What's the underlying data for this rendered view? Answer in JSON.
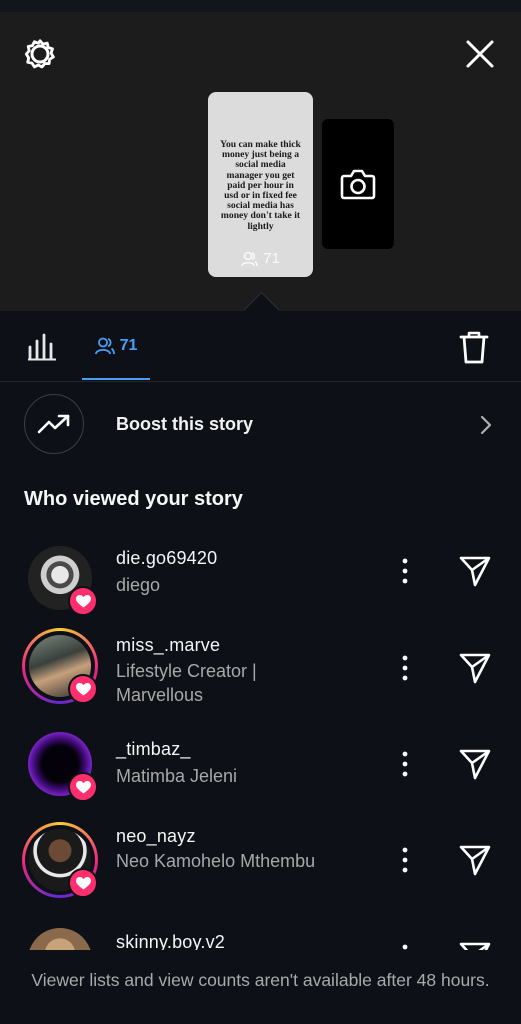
{
  "story": {
    "text": "You can make thick money just being a social media manager you get paid per hour in usd or in fixed fee social media has money don't take it lightly",
    "view_count": "71"
  },
  "tabs": {
    "viewers_count": "71"
  },
  "boost": {
    "label": "Boost this story"
  },
  "section_title": "Who viewed your story",
  "viewers": [
    {
      "username": "die.go69420",
      "name": "diego"
    },
    {
      "username": "miss_.marve",
      "name": "Lifestyle Creator | Marvellous"
    },
    {
      "username": "_timbaz_",
      "name": "Matimba Jeleni"
    },
    {
      "username": "neo_nayz",
      "name": "Neo Kamohelo Mthembu"
    },
    {
      "username": "skinny.boy.v2",
      "name": ""
    }
  ],
  "footer": {
    "text": "Viewer lists and view counts aren't available after 48 hours."
  },
  "colors": {
    "accent": "#4a9ff5",
    "heart": "#ff2f6e",
    "background": "#0d1117"
  }
}
